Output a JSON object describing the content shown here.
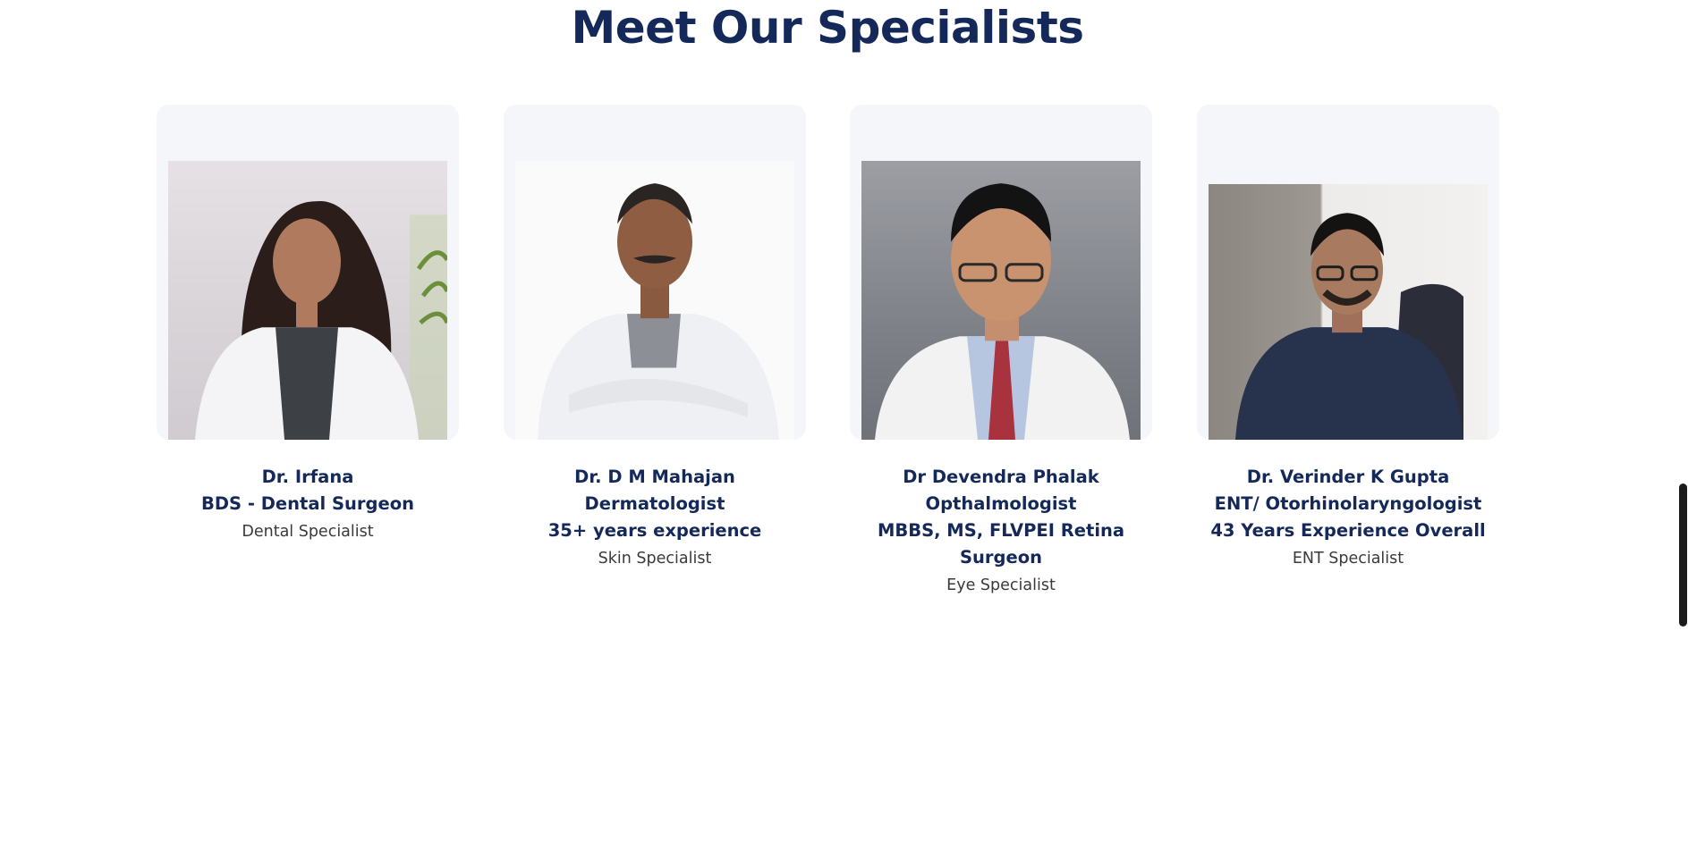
{
  "section": {
    "title": "Meet Our Specialists"
  },
  "specialists": [
    {
      "lines": [
        "Dr. Irfana",
        "BDS - Dental Surgeon"
      ],
      "specialty": "Dental Specialist",
      "photo": "doctor-photo-irfana"
    },
    {
      "lines": [
        "Dr. D M Mahajan",
        "Dermatologist",
        "35+ years experience"
      ],
      "specialty": "Skin Specialist",
      "photo": "doctor-photo-mahajan"
    },
    {
      "lines": [
        "Dr Devendra Phalak",
        "Opthalmologist",
        "MBBS, MS, FLVPEI Retina",
        "Surgeon"
      ],
      "specialty": "Eye Specialist",
      "photo": "doctor-photo-phalak"
    },
    {
      "lines": [
        "Dr. Verinder K Gupta",
        "ENT/ Otorhinolaryngologist",
        "43 Years Experience Overall"
      ],
      "specialty": "ENT Specialist",
      "photo": "doctor-photo-gupta"
    }
  ],
  "colors": {
    "heading": "#14295a",
    "card_background": "#f4f6fa",
    "specialty_text": "#3a3a3a"
  }
}
